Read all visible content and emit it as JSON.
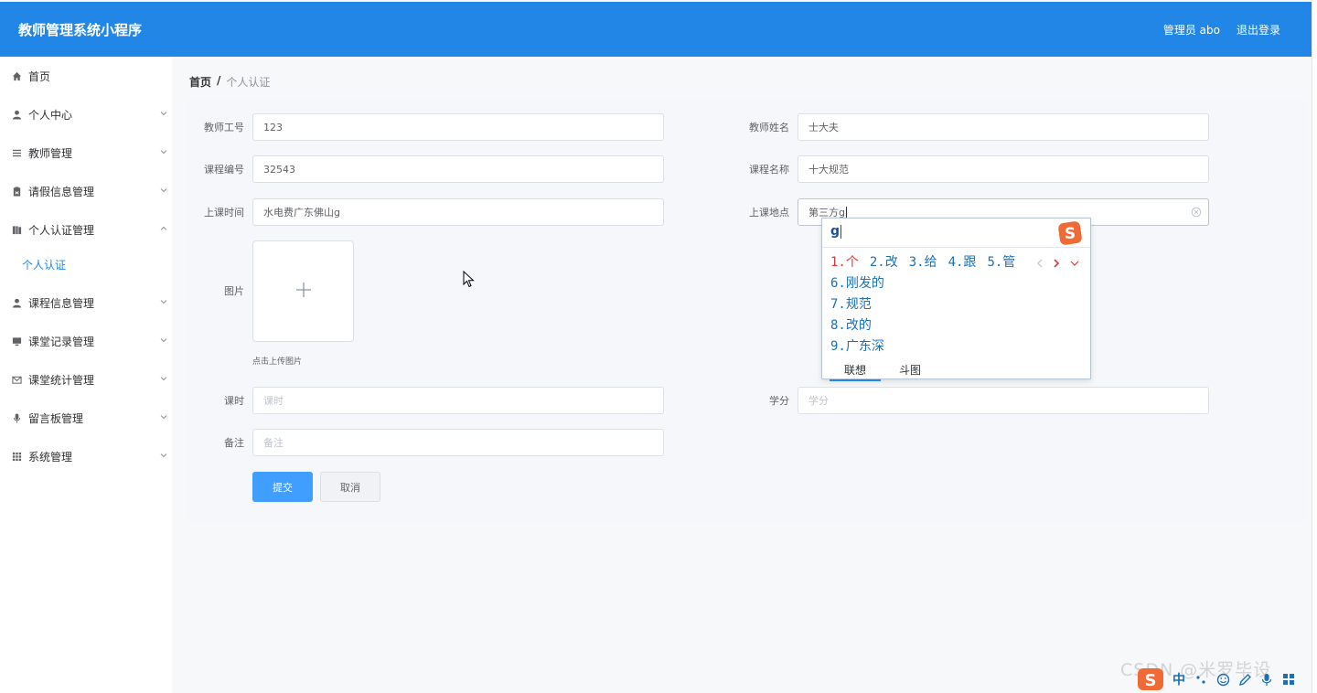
{
  "header": {
    "title": "教师管理系统小程序",
    "user_label": "管理员 abo",
    "logout_label": "退出登录"
  },
  "sidebar": {
    "items": [
      {
        "label": "首页",
        "icon": "home-icon",
        "has_children": false
      },
      {
        "label": "个人中心",
        "icon": "user-icon",
        "has_children": true
      },
      {
        "label": "教师管理",
        "icon": "list-icon",
        "has_children": true
      },
      {
        "label": "请假信息管理",
        "icon": "clipboard-icon",
        "has_children": true
      },
      {
        "label": "个人认证管理",
        "icon": "book-icon",
        "has_children": true,
        "expanded": true,
        "children": [
          {
            "label": "个人认证"
          }
        ]
      },
      {
        "label": "课程信息管理",
        "icon": "user-icon",
        "has_children": true
      },
      {
        "label": "课堂记录管理",
        "icon": "monitor-icon",
        "has_children": true
      },
      {
        "label": "课堂统计管理",
        "icon": "mail-icon",
        "has_children": true
      },
      {
        "label": "留言板管理",
        "icon": "microphone-icon",
        "has_children": true
      },
      {
        "label": "系统管理",
        "icon": "grid-icon",
        "has_children": true
      }
    ]
  },
  "breadcrumb": {
    "home": "首页",
    "separator": "/",
    "current": "个人认证"
  },
  "form": {
    "teacher_id": {
      "label": "教师工号",
      "value": "123"
    },
    "teacher_name": {
      "label": "教师姓名",
      "value": "士大夫"
    },
    "course_id": {
      "label": "课程编号",
      "value": "32543"
    },
    "course_name": {
      "label": "课程名称",
      "value": "十大规范"
    },
    "class_time": {
      "label": "上课时间",
      "value": "水电费广东佛山g"
    },
    "class_location": {
      "label": "上课地点",
      "value": "第三方g"
    },
    "image": {
      "label": "图片",
      "upload_tip": "点击上传图片"
    },
    "hours": {
      "label": "课时",
      "placeholder": "课时"
    },
    "credits": {
      "label": "学分",
      "placeholder": "学分"
    },
    "remark": {
      "label": "备注",
      "placeholder": "备注"
    },
    "submit_label": "提交",
    "cancel_label": "取消"
  },
  "ime": {
    "input": "g",
    "candidates_row": [
      "1.个",
      "2.改",
      "3.给",
      "4.跟",
      "5.管"
    ],
    "candidates_list": [
      "6.刚发的",
      "7.规范",
      "8.改的",
      "9.广东深"
    ],
    "tabs": [
      "联想",
      "斗图"
    ],
    "active_tab": "联想",
    "logo": "sogou-logo-icon"
  },
  "taskbar": {
    "watermark": "CSDN @米罗毕设",
    "ime_mode": "中"
  },
  "colors": {
    "header_bg": "#2186e6",
    "primary": "#409eff",
    "active_candidate": "#d9383a",
    "ime_logo": "#f06a35"
  }
}
